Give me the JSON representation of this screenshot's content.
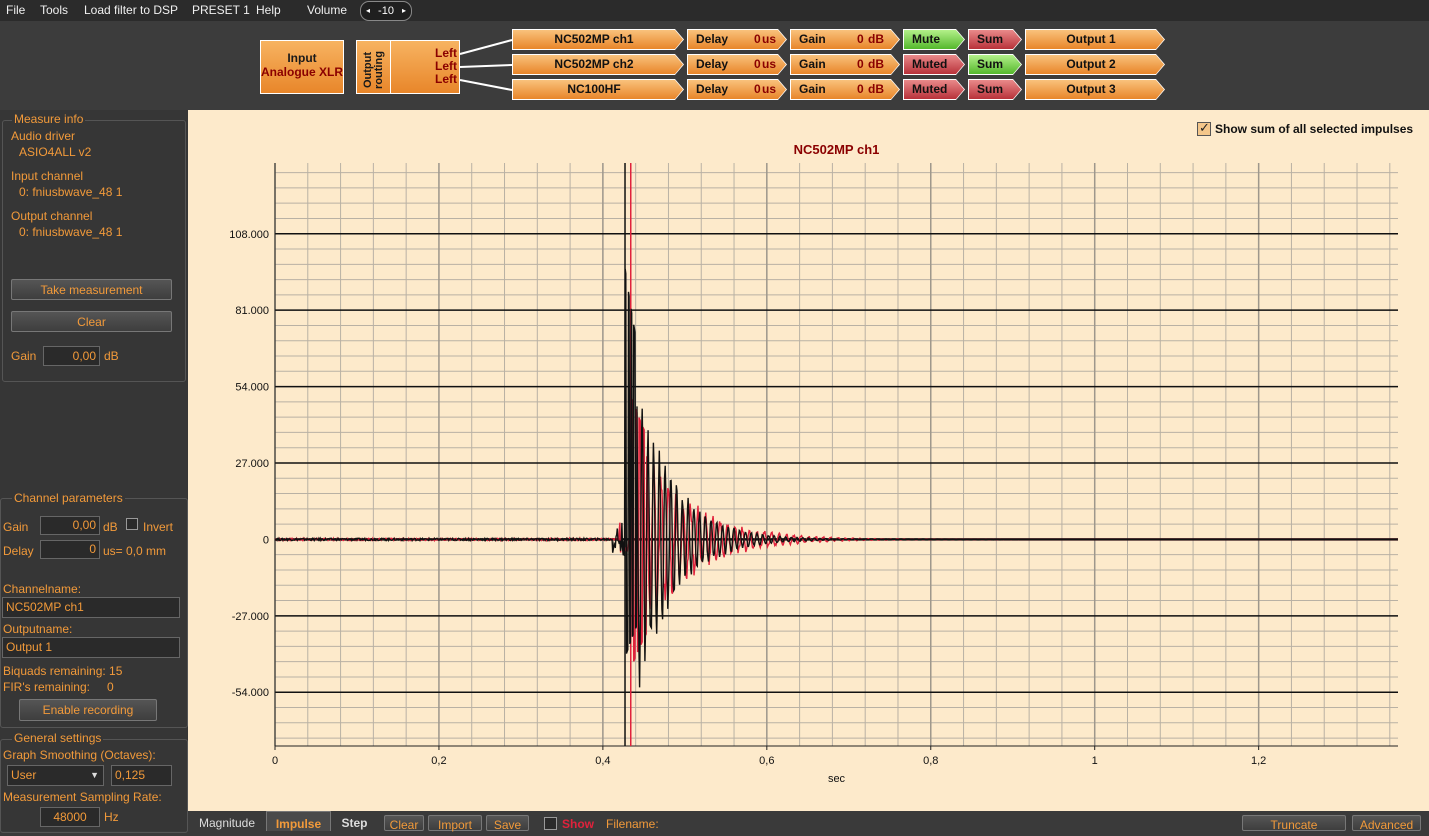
{
  "menu": {
    "file": "File",
    "tools": "Tools",
    "load": "Load filter to DSP",
    "preset": "PRESET 1",
    "help": "Help",
    "volume_label": "Volume",
    "volume_value": "-10"
  },
  "routing": {
    "input_title": "Input",
    "input_source": "Analogue XLR",
    "output_routing": "Output routing",
    "routes": [
      "Left",
      "Left",
      "Left"
    ],
    "channels": [
      {
        "name": "NC502MP ch1",
        "delay_label": "Delay",
        "delay_value": "0",
        "delay_unit": "us",
        "gain_label": "Gain",
        "gain_value": "0",
        "gain_unit": "dB",
        "mute": "Mute",
        "mute_state": "green",
        "sum": "Sum",
        "sum_state": "red",
        "output": "Output 1"
      },
      {
        "name": "NC502MP ch2",
        "delay_label": "Delay",
        "delay_value": "0",
        "delay_unit": "us",
        "gain_label": "Gain",
        "gain_value": "0",
        "gain_unit": "dB",
        "mute": "Muted",
        "mute_state": "red",
        "sum": "Sum",
        "sum_state": "green",
        "output": "Output 2"
      },
      {
        "name": "NC100HF",
        "delay_label": "Delay",
        "delay_value": "0",
        "delay_unit": "us",
        "gain_label": "Gain",
        "gain_value": "0",
        "gain_unit": "dB",
        "mute": "Muted",
        "mute_state": "red",
        "sum": "Sum",
        "sum_state": "red",
        "output": "Output 3"
      }
    ]
  },
  "measure": {
    "title": "Measure info",
    "driver_label": "Audio driver",
    "driver_value": "ASIO4ALL v2",
    "input_label": "Input channel",
    "input_value": "0: fniusbwave_48 1",
    "output_label": "Output channel",
    "output_value": "0: fniusbwave_48 1",
    "take": "Take measurement",
    "clear": "Clear",
    "gain_label": "Gain",
    "gain_value": "0,00",
    "gain_unit": "dB"
  },
  "channel_params": {
    "title": "Channel parameters",
    "gain_label": "Gain",
    "gain_value": "0,00",
    "gain_unit": "dB",
    "invert": "Invert",
    "delay_label": "Delay",
    "delay_value": "0",
    "delay_unit": "us= 0,0 mm",
    "channelname_label": "Channelname:",
    "channelname_value": "NC502MP ch1",
    "outputname_label": "Outputname:",
    "outputname_value": "Output 1",
    "biquads": "Biquads remaining: 15",
    "fir_label": "FIR's remaining:",
    "fir_value": "0",
    "enable_recording": "Enable recording"
  },
  "general": {
    "title": "General settings",
    "smoothing_label": "Graph Smoothing (Octaves):",
    "smoothing_mode": "User",
    "smoothing_value": "0,125",
    "sampling_label": "Measurement Sampling Rate:",
    "sampling_value": "48000",
    "sampling_unit": "Hz"
  },
  "graph": {
    "show_sum": "Show sum of all selected impulses"
  },
  "chart_data": {
    "type": "line",
    "title": "NC502MP ch1",
    "xlabel": "sec",
    "ylabel": "",
    "xlim": [
      0,
      1.37
    ],
    "ylim": [
      -73,
      133
    ],
    "xticks": [
      0,
      0.2,
      0.4,
      0.6,
      0.8,
      1,
      1.2
    ],
    "xtick_labels": [
      "0",
      "0,2",
      "0,4",
      "0,6",
      "0,8",
      "1",
      "1,2"
    ],
    "yticks": [
      108,
      81,
      54,
      27,
      0,
      -27,
      -54
    ],
    "ytick_labels": [
      "108.000",
      "81.000",
      "54.000",
      "27.000",
      "0",
      "-27.000",
      "-54.000"
    ],
    "grid": true,
    "series": [
      {
        "color": "#e0223c",
        "peak_x": 0.435,
        "peak": 50,
        "trough": -45,
        "decay": 0.06,
        "period": 0.009
      },
      {
        "color": "#111111",
        "peak_x": 0.427,
        "peak": 96,
        "trough": -42,
        "decay": 0.045,
        "period": 0.007
      }
    ],
    "markers": [
      {
        "x": 0.427,
        "color": "#111111"
      },
      {
        "x": 0.434,
        "color": "#e0223c"
      }
    ]
  },
  "bottom": {
    "tabs": [
      "Magnitude",
      "Impulse",
      "Step"
    ],
    "clear": "Clear",
    "import": "Import",
    "save": "Save",
    "show": "Show",
    "filename": "Filename:",
    "truncate": "Truncate",
    "advanced": "Advanced"
  }
}
